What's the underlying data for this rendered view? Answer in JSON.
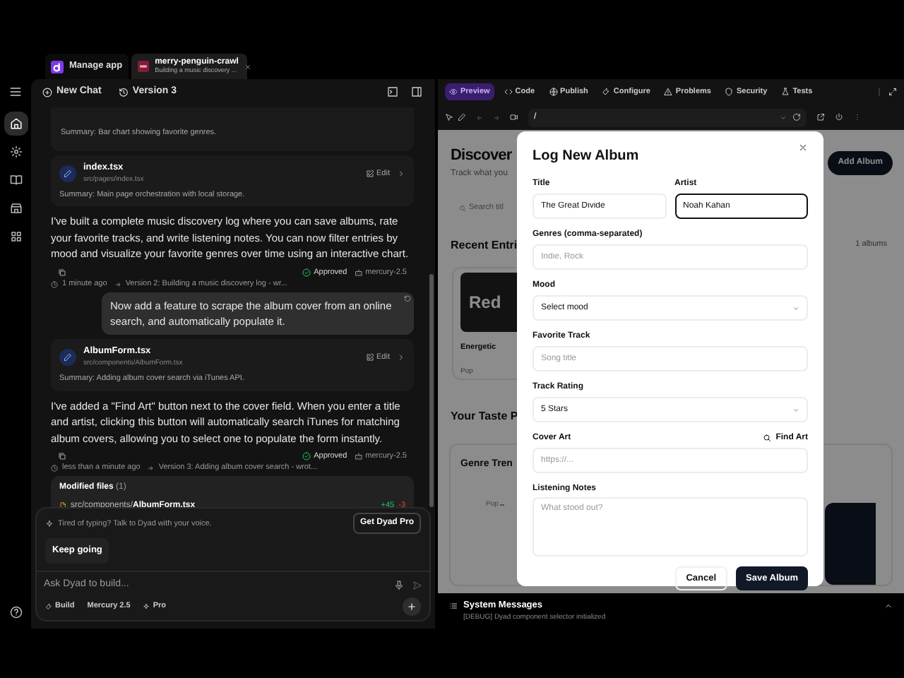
{
  "tabs": [
    {
      "kind": "home",
      "label": "Manage app",
      "selected": false
    },
    {
      "kind": "app",
      "title": "merry-penguin-crawl",
      "subtitle": "Building a music discovery ...",
      "selected": true
    }
  ],
  "rail": {
    "items": [
      {
        "selected": true
      },
      {
        "selected": false
      },
      {
        "selected": false
      },
      {
        "selected": false
      },
      {
        "selected": false
      }
    ]
  },
  "chat_header": {
    "new_chat": "New Chat",
    "version": "Version 3"
  },
  "messages": [
    {
      "kind": "summary",
      "text": "Summary: Bar chart showing favorite genres."
    },
    {
      "kind": "file",
      "name": "index.tsx",
      "path": "src/pages/index.tsx",
      "action": "Edit",
      "summary": "Summary: Main page orchestration with local storage."
    },
    {
      "kind": "assistant",
      "text": "I've built a complete music discovery log where you can save albums, rate your favorite tracks, and write listening notes. You can now filter entries by mood and visualize your favorite genres over time using an interactive chart."
    },
    {
      "kind": "meta",
      "status": "Approved",
      "model": "mercury-2.5"
    },
    {
      "kind": "version",
      "time": "1 minute ago",
      "version": "Version 2: Building a music discovery log - wr..."
    },
    {
      "kind": "user",
      "text": "Now add a feature to scrape the album cover from an online search, and automatically populate it."
    },
    {
      "kind": "file",
      "name": "AlbumForm.tsx",
      "path": "src/components/AlbumForm.tsx",
      "action": "Edit",
      "summary": "Summary: Adding album cover search via iTunes API."
    },
    {
      "kind": "assistant",
      "text": "I've added a \"Find Art\" button next to the cover field. When you enter a title and artist, clicking this button will automatically search iTunes for matching album covers, allowing you to select one to populate the form instantly."
    },
    {
      "kind": "meta",
      "status": "Approved",
      "model": "mercury-2.5"
    },
    {
      "kind": "version",
      "time": "less than a minute ago",
      "version": "Version 3: Adding album cover search - wrot..."
    }
  ],
  "modified_files": {
    "title": "Modified files",
    "count": "(1)",
    "files": [
      {
        "path": "src/components/**AlbumForm.tsx**",
        "added": "+45",
        "removed": "-3"
      }
    ]
  },
  "promo": {
    "text": "Tired of typing? Talk to Dyad with your voice.",
    "button": "Get Dyad Pro"
  },
  "suggestions": [
    "Keep going"
  ],
  "composer": {
    "placeholder": "Ask Dyad to build...",
    "modes": [
      "Build",
      "Mercury 2.5",
      "Pro"
    ]
  },
  "preview_tabs": [
    {
      "label": "Preview",
      "selected": true
    },
    {
      "label": "Code",
      "selected": false
    },
    {
      "label": "Publish",
      "selected": false
    },
    {
      "label": "Configure",
      "selected": false
    },
    {
      "label": "Problems",
      "selected": false
    },
    {
      "label": "Security",
      "selected": false
    },
    {
      "label": "Tests",
      "selected": false
    }
  ],
  "address_bar": {
    "value": "/"
  },
  "page": {
    "heading": "Discover",
    "subtitle": "Track what you",
    "search_placeholder": "Search titl",
    "add_button": "Add Album",
    "recent_heading": "Recent Entri",
    "count": "1 albums",
    "card": {
      "cover": "Red",
      "mood": "Energetic",
      "genre": "Pop"
    },
    "taste_heading": "Your Taste P",
    "chart_title": "Genre Tren",
    "chart_label": "Pop"
  },
  "modal": {
    "title": "Log New Album",
    "fields": [
      {
        "kind": "text",
        "label": "Title",
        "value": "The Great Divide",
        "focused": false
      },
      {
        "kind": "text",
        "label": "Artist",
        "value": "Noah Kahan",
        "focused": true
      },
      {
        "kind": "text",
        "label": "Genres (comma-separated)",
        "placeholder": "Indie, Rock",
        "focused": false
      },
      {
        "kind": "select",
        "label": "Mood",
        "value": "Select mood",
        "focused": false
      },
      {
        "kind": "text",
        "label": "Favorite Track",
        "placeholder": "Song title",
        "focused": false
      },
      {
        "kind": "select",
        "label": "Track Rating",
        "value": "5 Stars",
        "focused": false
      },
      {
        "kind": "text",
        "label": "Cover Art",
        "placeholder": "https://...",
        "action": "Find Art",
        "focused": false
      },
      {
        "kind": "textarea",
        "label": "Listening Notes",
        "placeholder": "What stood out?",
        "focused": false
      }
    ],
    "buttons": [
      {
        "kind": "secondary",
        "label": "Cancel"
      },
      {
        "kind": "primary",
        "label": "Save Album"
      }
    ]
  },
  "system_messages": {
    "title": "System Messages",
    "lines": [
      "[DEBUG] Dyad component selector initialized"
    ]
  }
}
